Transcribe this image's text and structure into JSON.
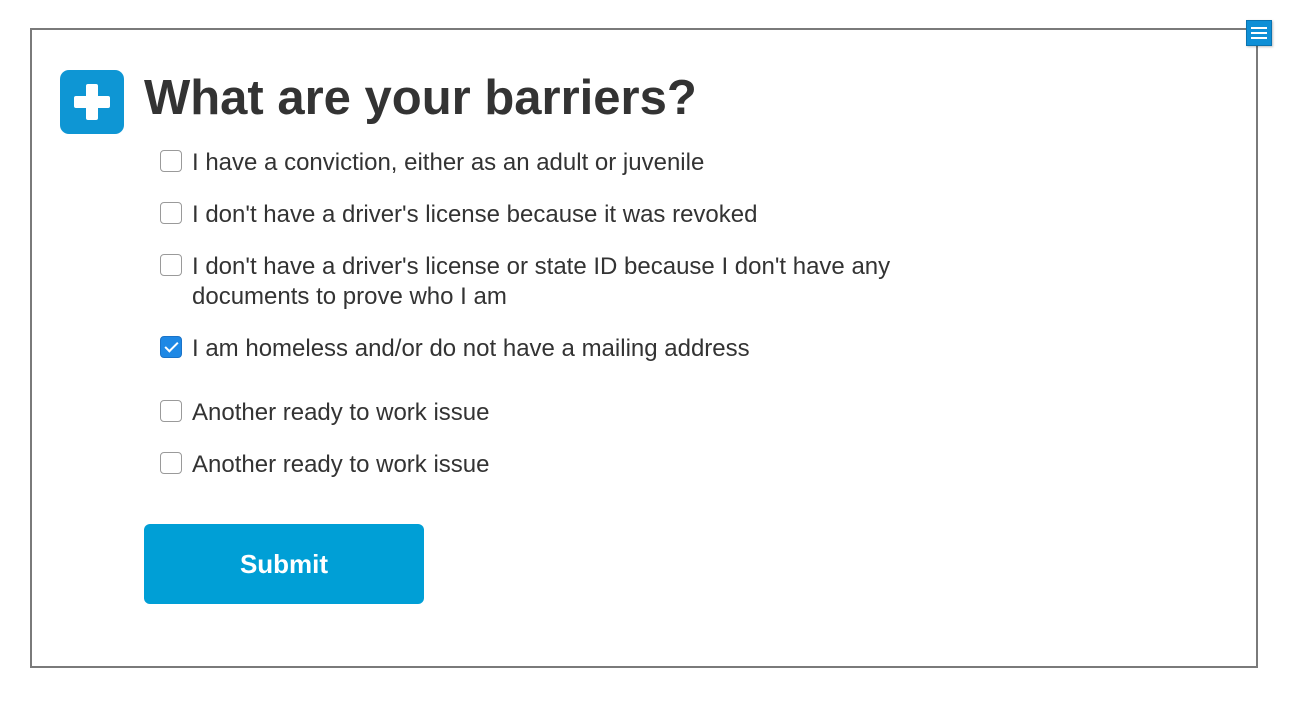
{
  "header": {
    "title": "What are your barriers?",
    "icon": "plus-icon",
    "icon_color": "#0e96d4"
  },
  "menu": {
    "icon": "hamburger-menu-icon",
    "color": "#0e8fd6"
  },
  "options": [
    {
      "label": "I have a conviction, either as an adult or juvenile",
      "checked": false
    },
    {
      "label": "I don't have a driver's license because it was revoked",
      "checked": false
    },
    {
      "label": "I don't have a driver's license or state ID because I don't have any documents to prove who I am",
      "checked": false
    },
    {
      "label": "I am homeless and/or do not have a mailing address",
      "checked": true
    },
    {
      "label": "Another ready to work issue",
      "checked": false
    },
    {
      "label": "Another ready to work issue",
      "checked": false
    }
  ],
  "submit": {
    "label": "Submit",
    "color": "#009fd6"
  }
}
